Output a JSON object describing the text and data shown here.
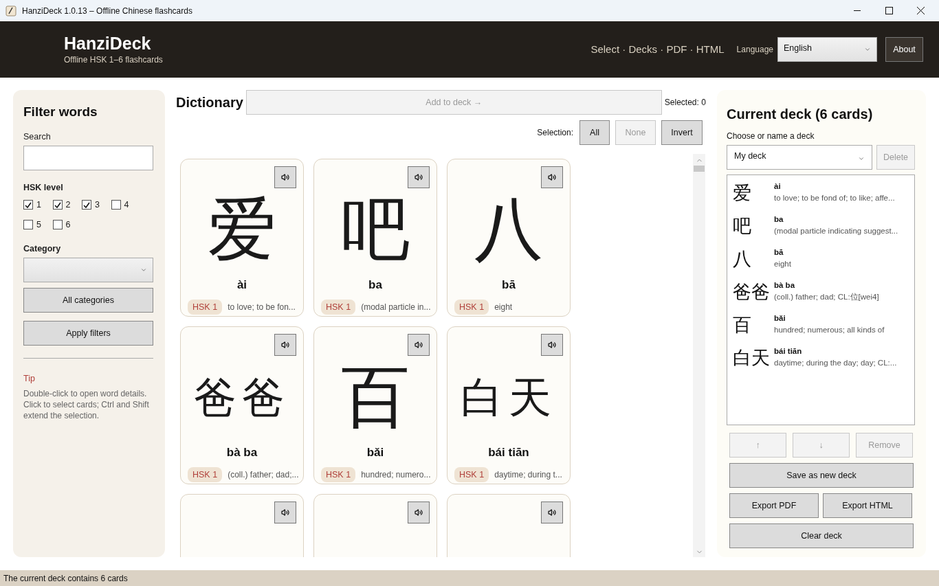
{
  "window": {
    "title": "HanziDeck 1.0.13 – Offline Chinese flashcards"
  },
  "header": {
    "app_name": "HanziDeck",
    "subtitle": "Offline HSK 1–6 flashcards",
    "nav": "Select · Decks · PDF · HTML",
    "language_label": "Language",
    "language_value": "English",
    "about_button": "About"
  },
  "filter": {
    "title": "Filter words",
    "search_label": "Search",
    "hsk_label": "HSK level",
    "levels": [
      {
        "label": "1",
        "checked": true
      },
      {
        "label": "2",
        "checked": true
      },
      {
        "label": "3",
        "checked": true
      },
      {
        "label": "4",
        "checked": false
      },
      {
        "label": "5",
        "checked": false
      },
      {
        "label": "6",
        "checked": false
      }
    ],
    "category_label": "Category",
    "buttons": [
      "All categories",
      "Apply filters"
    ],
    "tip_title": "Tip",
    "tip_text": "Double-click to open word details. Click to select cards; Ctrl and Shift extend the selection."
  },
  "dictionary": {
    "title": "Dictionary",
    "add_button": {
      "label": "Add to deck →",
      "disabled": true
    },
    "selected": "Selected: 0",
    "selection_label": "Selection:",
    "selection_buttons": [
      {
        "label": "All",
        "disabled": false
      },
      {
        "label": "None",
        "disabled": true
      },
      {
        "label": "Invert",
        "disabled": false
      }
    ],
    "cards": [
      {
        "kind": "full",
        "hanzi": "爱",
        "pinyin": "ài",
        "level": "HSK 1",
        "gloss": "to love; to be fon..."
      },
      {
        "kind": "full",
        "hanzi": "吧",
        "pinyin": "ba",
        "level": "HSK 1",
        "gloss": "(modal particle in..."
      },
      {
        "kind": "full",
        "hanzi": "八",
        "pinyin": "bā",
        "level": "HSK 1",
        "gloss": "eight"
      },
      {
        "kind": "full",
        "hanzi": "爸爸",
        "pinyin": "bà ba",
        "level": "HSK 1",
        "gloss": "(coll.) father; dad;..."
      },
      {
        "kind": "full",
        "hanzi": "百",
        "pinyin": "bǎi",
        "level": "HSK 1",
        "gloss": "hundred; numero..."
      },
      {
        "kind": "full",
        "hanzi": "白天",
        "pinyin": "bái tiān",
        "level": "HSK 1",
        "gloss": "daytime; during t..."
      },
      {
        "kind": "cut"
      },
      {
        "kind": "cut"
      },
      {
        "kind": "cut"
      }
    ]
  },
  "deck": {
    "title": "Current deck (6 cards)",
    "choose_label": "Choose or name a deck",
    "deck_value": "My deck",
    "delete_button": {
      "label": "Delete",
      "disabled": true
    },
    "items": [
      {
        "hanzi": "爱",
        "pinyin": "ài",
        "gloss": "to love; to be fond of; to like; affe..."
      },
      {
        "hanzi": "吧",
        "pinyin": "ba",
        "gloss": "(modal particle indicating suggest..."
      },
      {
        "hanzi": "八",
        "pinyin": "bā",
        "gloss": "eight"
      },
      {
        "hanzi": "爸爸",
        "pinyin": "bà ba",
        "gloss": "(coll.) father; dad; CL:位[wei4]"
      },
      {
        "hanzi": "百",
        "pinyin": "bǎi",
        "gloss": "hundred; numerous; all kinds of"
      },
      {
        "hanzi": "白天",
        "pinyin": "bái tiān",
        "gloss": "daytime; during the day; day; CL:..."
      }
    ],
    "move_buttons": [
      {
        "label": "↑",
        "disabled": true
      },
      {
        "label": "↓",
        "disabled": true
      },
      {
        "label": "Remove",
        "disabled": true
      }
    ],
    "save_button": "Save as new deck",
    "export_buttons": [
      "Export PDF",
      "Export HTML"
    ],
    "clear_button": "Clear deck"
  },
  "status_bar": "The current deck contains 6 cards"
}
